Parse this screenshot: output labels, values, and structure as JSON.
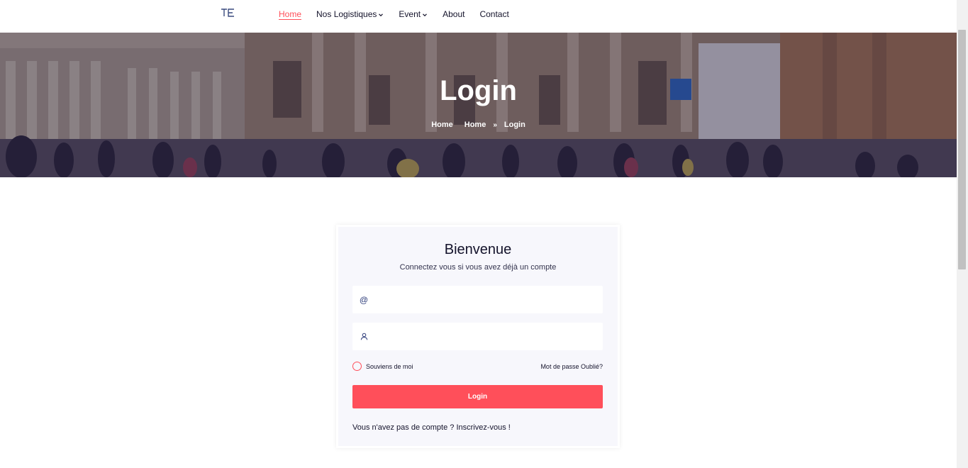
{
  "logo": {
    "text": "TE",
    "color": "#3a4a7e"
  },
  "nav": {
    "items": [
      {
        "label": "Home",
        "active": true,
        "dropdown": false
      },
      {
        "label": "Nos Logistiques",
        "active": false,
        "dropdown": true
      },
      {
        "label": "Event",
        "active": false,
        "dropdown": true
      },
      {
        "label": "About",
        "active": false,
        "dropdown": false
      },
      {
        "label": "Contact",
        "active": false,
        "dropdown": false
      }
    ]
  },
  "hero": {
    "title": "Login",
    "breadcrumbs": [
      "Home",
      "Home",
      "Login"
    ]
  },
  "login": {
    "heading": "Bienvenue",
    "subheading": "Connectez vous si vous avez déjà un compte",
    "email_icon": "@",
    "email_value": "",
    "username_value": "",
    "remember_label": "Souviens de moi",
    "forgot_label": "Mot de passe Oublié?",
    "submit_label": "Login",
    "signup_text": "Vous n'avez pas de compte ?",
    "signup_link": "Inscrivez-vous !"
  },
  "colors": {
    "accent": "#ff4f5a",
    "text": "#14132b",
    "card_bg": "#f7f7fc",
    "hero_overlay": "#1e1a46"
  },
  "icons": [
    "logo-icon",
    "chevron-down-icon",
    "at-icon",
    "user-icon",
    "radio-icon"
  ]
}
